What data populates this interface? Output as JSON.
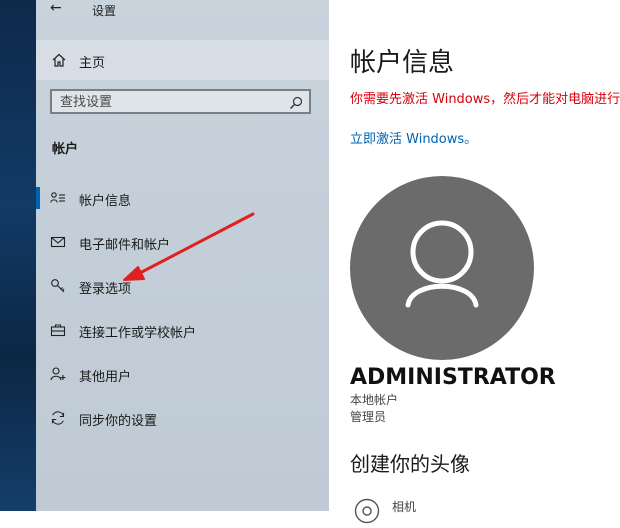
{
  "window": {
    "back_glyph": "←",
    "title": "设置"
  },
  "sidebar": {
    "home_label": "主页",
    "search_placeholder": "查找设置",
    "section_heading": "帐户",
    "items": [
      {
        "label": "帐户信息",
        "icon": "account-info-icon",
        "selected": true
      },
      {
        "label": "电子邮件和帐户",
        "icon": "mail-icon",
        "selected": false
      },
      {
        "label": "登录选项",
        "icon": "key-icon",
        "selected": false
      },
      {
        "label": "连接工作或学校帐户",
        "icon": "briefcase-icon",
        "selected": false
      },
      {
        "label": "其他用户",
        "icon": "person-add-icon",
        "selected": false
      },
      {
        "label": "同步你的设置",
        "icon": "sync-icon",
        "selected": false
      }
    ]
  },
  "main": {
    "title": "帐户信息",
    "activation_warning": "你需要先激活 Windows，然后才能对电脑进行个性化设置。",
    "activate_link": "立即激活 Windows。",
    "user_name": "ADMINISTRATOR",
    "account_type": "本地帐户",
    "account_role": "管理员",
    "avatar_heading": "创建你的头像",
    "camera_label": "相机"
  },
  "colors": {
    "accent": "#0063b1",
    "warning": "#d8000c",
    "avatar_bg": "#6b6b6b",
    "annotation_arrow": "#e02020"
  }
}
